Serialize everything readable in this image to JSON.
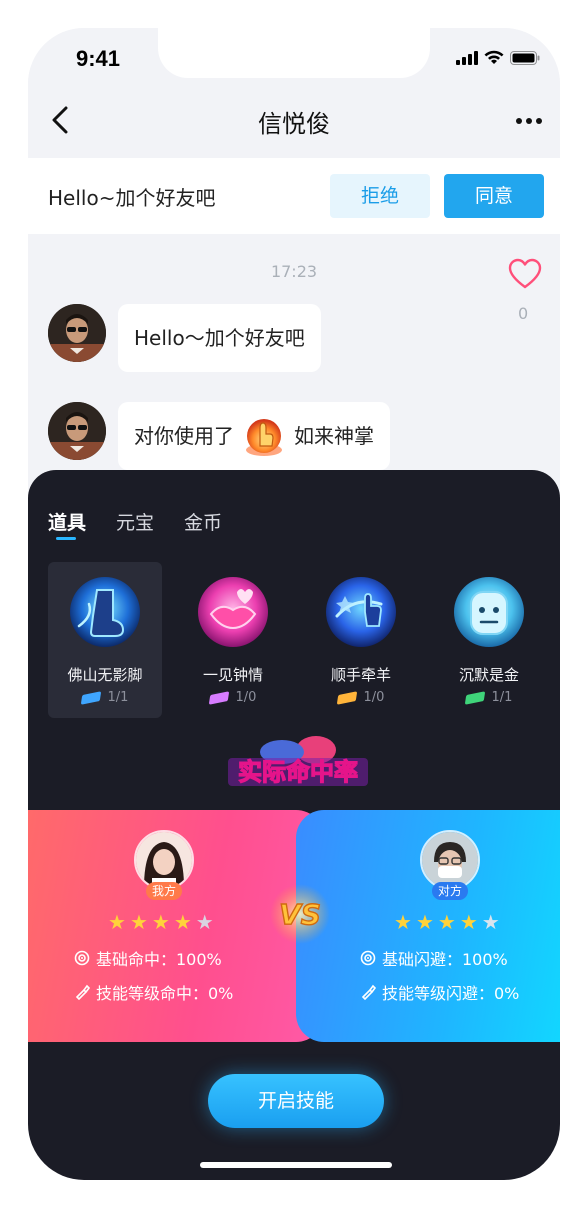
{
  "status_bar": {
    "time": "9:41"
  },
  "nav": {
    "title": "信悦俊"
  },
  "friend_request": {
    "message": "Hello~加个好友吧",
    "reject_label": "拒绝",
    "accept_label": "同意"
  },
  "chat": {
    "timestamp": "17:23",
    "like_count": "0",
    "messages": [
      {
        "text": "Hello～加个好友吧"
      },
      {
        "prefix": "对你使用了",
        "gift": "如来神掌"
      }
    ]
  },
  "panel": {
    "tabs": [
      {
        "label": "道具"
      },
      {
        "label": "元宝"
      },
      {
        "label": "金币"
      }
    ],
    "items": [
      {
        "name": "佛山无影脚",
        "count": "1/1",
        "ticket_color": "#3fa6ff",
        "icon": "foot-icon"
      },
      {
        "name": "一见钟情",
        "count": "1/0",
        "ticket_color": "#d77cff",
        "icon": "lips-icon"
      },
      {
        "name": "顺手牵羊",
        "count": "1/0",
        "ticket_color": "#ffb43a",
        "icon": "grab-hand-icon"
      },
      {
        "name": "沉默是金",
        "count": "1/1",
        "ticket_color": "#3fd47a",
        "icon": "silent-face-icon"
      }
    ],
    "banner_title": "实际命中率",
    "me": {
      "tag": "我方",
      "rating": 4,
      "stat1": "基础命中：100%",
      "stat2": "技能等级命中：0%"
    },
    "opponent": {
      "tag": "对方",
      "rating": 4,
      "stat1": "基础闪避：100%",
      "stat2": "技能等级闪避：0%"
    },
    "vs_label": "VS",
    "start_label": "开启技能"
  },
  "colors": {
    "accent": "#22a6ee",
    "panel_bg": "#1b1c26",
    "left_card": "#ff4f8e",
    "right_card": "#1fb5ff"
  }
}
